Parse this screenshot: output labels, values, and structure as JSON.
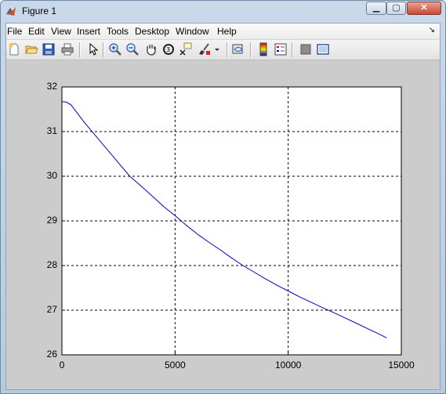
{
  "window": {
    "title": "Figure 1"
  },
  "menu": [
    "File",
    "Edit",
    "View",
    "Insert",
    "Tools",
    "Desktop",
    "Window",
    "Help"
  ],
  "toolbar_icons": [
    "new-figure-icon",
    "open-file-icon",
    "save-icon",
    "print-icon",
    "edit-plot-arrow-icon",
    "zoom-in-icon",
    "zoom-out-icon",
    "pan-hand-icon",
    "rotate-3d-icon",
    "data-cursor-icon",
    "brush-icon",
    "brush-dropdown-icon",
    "link-plot-icon",
    "insert-colorbar-icon",
    "insert-legend-icon",
    "hide-plot-tools-icon",
    "show-plot-tools-icon"
  ],
  "chart_data": {
    "type": "line",
    "xlim": [
      0,
      15000
    ],
    "ylim": [
      26,
      32
    ],
    "xticks": [
      "0",
      "5000",
      "10000",
      "15000"
    ],
    "yticks": [
      "26",
      "27",
      "28",
      "29",
      "30",
      "31",
      "32"
    ],
    "grid": true,
    "line_color": "#0000cc",
    "series": [
      {
        "x": [
          0,
          200,
          400,
          700,
          1000,
          1500,
          2000,
          2500,
          3000,
          3500,
          4000,
          4500,
          5000,
          5500,
          6000,
          6500,
          7000,
          7500,
          8000,
          8500,
          9000,
          9500,
          10000,
          10500,
          11000,
          11500,
          12000,
          12500,
          13000,
          13500,
          14000,
          14350
        ],
        "y": [
          31.67,
          31.66,
          31.6,
          31.4,
          31.2,
          30.9,
          30.6,
          30.3,
          30.0,
          29.78,
          29.55,
          29.32,
          29.12,
          28.9,
          28.7,
          28.52,
          28.35,
          28.17,
          28.0,
          27.85,
          27.7,
          27.56,
          27.43,
          27.3,
          27.18,
          27.06,
          26.95,
          26.83,
          26.71,
          26.59,
          26.47,
          26.38
        ]
      }
    ]
  }
}
